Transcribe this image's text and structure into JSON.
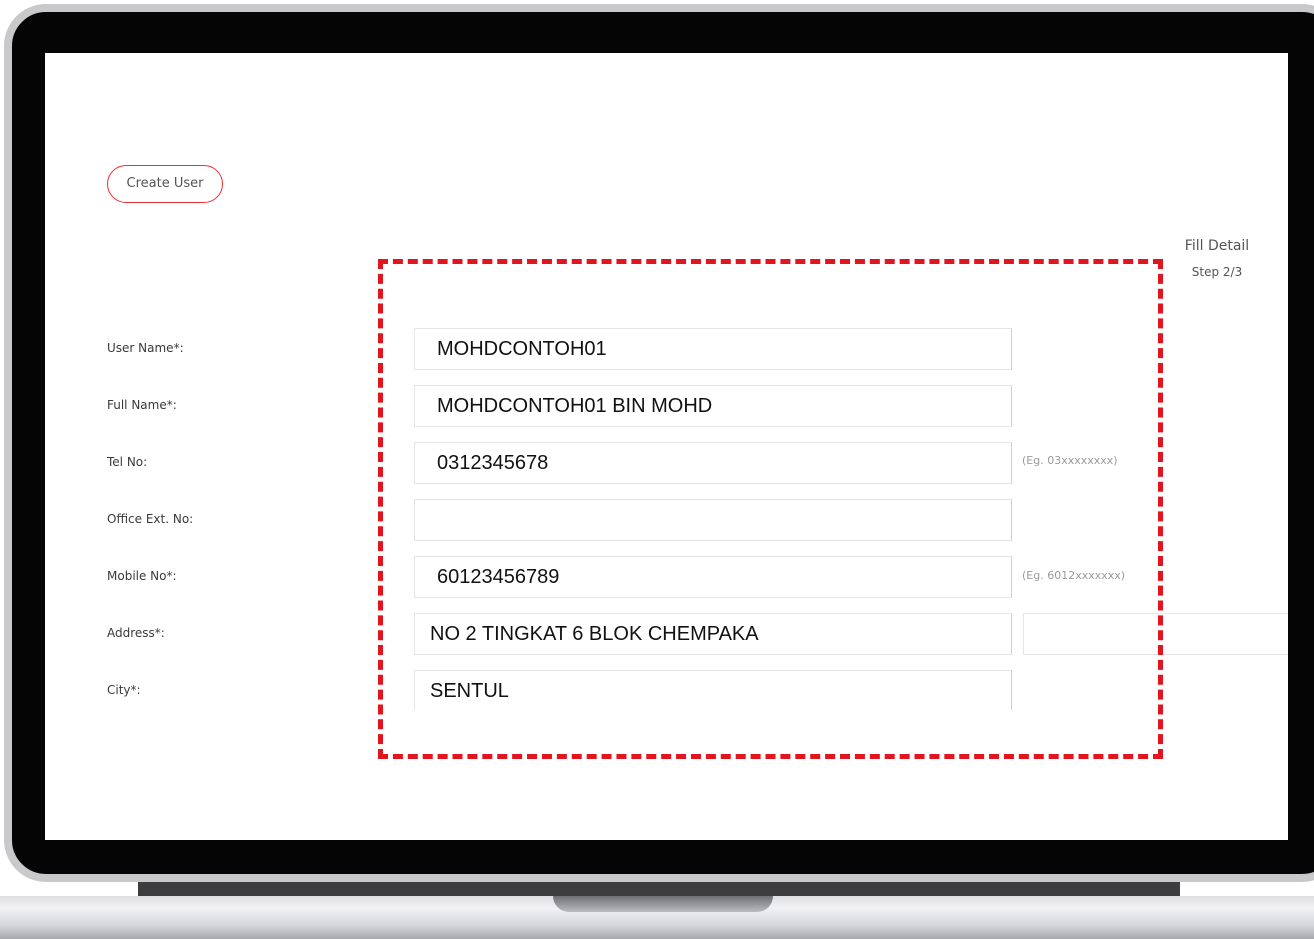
{
  "page": {
    "create_user_label": "Create User",
    "step_title": "Fill Detail",
    "step_count": "Step 2/3"
  },
  "form": {
    "fields": [
      {
        "label": "User Name*:",
        "value": "MOHDCONTOH01",
        "hint": ""
      },
      {
        "label": "Full Name*:",
        "value": "MOHDCONTOH01 BIN MOHD",
        "hint": ""
      },
      {
        "label": "Tel No:",
        "value": "0312345678",
        "hint": "(Eg. 03xxxxxxxx)"
      },
      {
        "label": "Office Ext. No:",
        "value": "",
        "hint": ""
      },
      {
        "label": "Mobile No*:",
        "value": "60123456789",
        "hint": "(Eg. 6012xxxxxxx)"
      },
      {
        "label": "Address*:",
        "value": "NO 2 TINGKAT 6 BLOK CHEMPAKA",
        "extra_value": "",
        "hint": ""
      },
      {
        "label": "City*:",
        "value": "SENTUL",
        "hint": ""
      }
    ]
  },
  "colors": {
    "accent": "#E2141D",
    "button_border": "#EA3037",
    "device_frame": "#050505",
    "hint_text": "#9A9A9A"
  }
}
